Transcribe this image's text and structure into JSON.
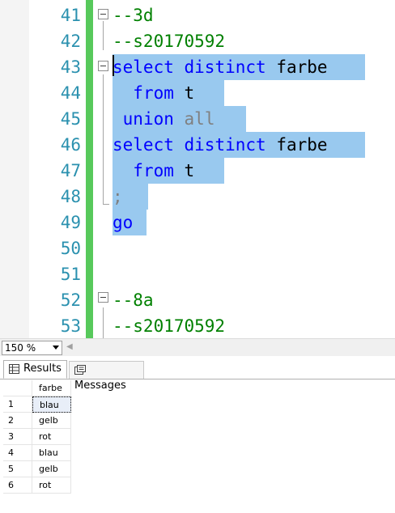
{
  "editor": {
    "lines": [
      {
        "number": "41",
        "segments": [
          {
            "text": "--3d",
            "cls": "cm"
          }
        ]
      },
      {
        "number": "42",
        "segments": [
          {
            "text": "--s20170592",
            "cls": "cm"
          }
        ]
      },
      {
        "number": "43",
        "segments": [
          {
            "text": "select",
            "cls": "kw"
          },
          {
            "text": " ",
            "cls": "tx"
          },
          {
            "text": "distinct",
            "cls": "kw"
          },
          {
            "text": " farbe",
            "cls": "tx"
          }
        ]
      },
      {
        "number": "44",
        "segments": [
          {
            "text": "  ",
            "cls": "tx"
          },
          {
            "text": "from",
            "cls": "kw"
          },
          {
            "text": " t",
            "cls": "tx"
          }
        ]
      },
      {
        "number": "45",
        "segments": [
          {
            "text": " ",
            "cls": "tx"
          },
          {
            "text": "union",
            "cls": "kw"
          },
          {
            "text": " ",
            "cls": "tx"
          },
          {
            "text": "all",
            "cls": "gr"
          }
        ]
      },
      {
        "number": "46",
        "segments": [
          {
            "text": "select",
            "cls": "kw"
          },
          {
            "text": " ",
            "cls": "tx"
          },
          {
            "text": "distinct",
            "cls": "kw"
          },
          {
            "text": " farbe",
            "cls": "tx"
          }
        ]
      },
      {
        "number": "47",
        "segments": [
          {
            "text": "  ",
            "cls": "tx"
          },
          {
            "text": "from",
            "cls": "kw"
          },
          {
            "text": " t",
            "cls": "tx"
          }
        ]
      },
      {
        "number": "48",
        "segments": [
          {
            "text": ";",
            "cls": "gr"
          }
        ]
      },
      {
        "number": "49",
        "segments": [
          {
            "text": "go",
            "cls": "kw"
          }
        ]
      },
      {
        "number": "50",
        "segments": []
      },
      {
        "number": "51",
        "segments": []
      },
      {
        "number": "52",
        "segments": [
          {
            "text": "--8a",
            "cls": "cm"
          }
        ]
      },
      {
        "number": "53",
        "segments": [
          {
            "text": "--s20170592",
            "cls": "cm"
          }
        ]
      }
    ]
  },
  "zoom": {
    "value": "150 %"
  },
  "tabs": {
    "results_label": "Results",
    "messages_label": "Messages"
  },
  "results": {
    "column_header": "farbe",
    "rows": [
      {
        "num": "1",
        "value": "blau"
      },
      {
        "num": "2",
        "value": "gelb"
      },
      {
        "num": "3",
        "value": "rot"
      },
      {
        "num": "4",
        "value": "blau"
      },
      {
        "num": "5",
        "value": "gelb"
      },
      {
        "num": "6",
        "value": "rot"
      }
    ]
  },
  "colors": {
    "keyword": "#0000ff",
    "comment": "#008000",
    "operator": "#808080",
    "line_number": "#2b91af",
    "selection": "#99c9ef",
    "change_bar": "#57c95b"
  }
}
